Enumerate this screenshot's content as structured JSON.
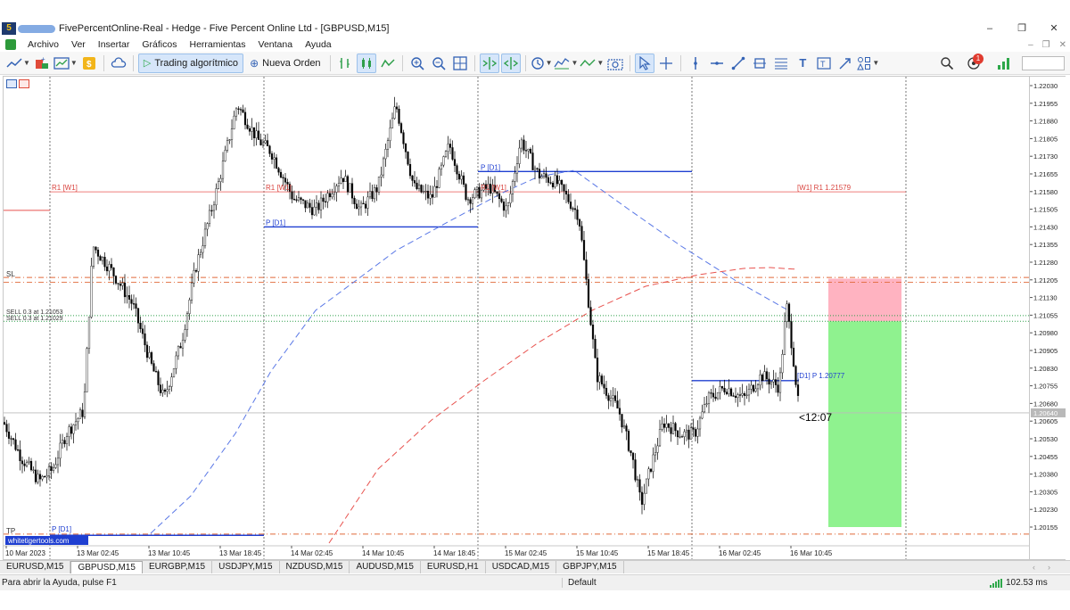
{
  "window": {
    "app_logo": "5",
    "title": "FivePercentOnline-Real - Hedge - Five Percent Online Ltd - [GBPUSD,M15]",
    "controls": [
      "–",
      "❐",
      "✕"
    ]
  },
  "menu": {
    "items": [
      "Archivo",
      "Ver",
      "Insertar",
      "Gráficos",
      "Herramientas",
      "Ventana",
      "Ayuda"
    ],
    "mdi_controls": [
      "–",
      "❐",
      "✕"
    ]
  },
  "toolbar": {
    "algo_trading_label": "Trading algorítmico",
    "new_order_label": "Nueva Orden",
    "notification_count": "1"
  },
  "chart": {
    "symbol": "GBPUSD",
    "timeframe": "M15",
    "price_axis_labels": [
      "1.22030",
      "1.21955",
      "1.21880",
      "1.21805",
      "1.21730",
      "1.21655",
      "1.21580",
      "1.21505",
      "1.21430",
      "1.21355",
      "1.21280",
      "1.21205",
      "1.21130",
      "1.21055",
      "1.20980",
      "1.20905",
      "1.20830",
      "1.20755",
      "1.20680",
      "1.20605",
      "1.20530",
      "1.20455",
      "1.20380",
      "1.20305",
      "1.20230",
      "1.20155"
    ],
    "current_price_label": "1.20640",
    "time_axis_labels": [
      "10 Mar 2023",
      "13 Mar 02:45",
      "13 Mar 10:45",
      "13 Mar 18:45",
      "14 Mar 02:45",
      "14 Mar 10:45",
      "14 Mar 18:45",
      "15 Mar 02:45",
      "15 Mar 10:45",
      "15 Mar 18:45",
      "16 Mar 02:45",
      "16 Mar 10:45"
    ],
    "countdown": "<12:07",
    "watermark": "whitetigertools.com",
    "level_labels": {
      "r1_w1_left": "R1 [W1]",
      "r1_w1_mid1": "R1 [W1]",
      "r1_w1_mid2": "R1 [W1]",
      "r1_w1_right": "[W1] R1 1.21579",
      "p_d1_1": "P [D1]",
      "p_d1_2": "P [D1]",
      "p_d1_3": "P [D1]",
      "p_d1_right": "[D1] P 1.20777",
      "sl": "SL",
      "tp": "TP",
      "sell1": "SELL 0.3 at 1.21053",
      "sell2": "SELL 0.3 at 1.21029"
    }
  },
  "tabs": [
    "EURUSD,M15",
    "GBPUSD,M15",
    "EURGBP,M15",
    "USDJPY,M15",
    "NZDUSD,M15",
    "AUDUSD,M15",
    "EURUSD,H1",
    "USDCAD,M15",
    "GBPJPY,M15"
  ],
  "active_tab_index": 1,
  "status": {
    "help": "Para abrir la Ayuda, pulse F1",
    "profile": "Default",
    "ping": "102.53 ms"
  },
  "colors": {
    "bull_candle": "#ffffff",
    "bear_candle": "#000000",
    "pivot_blue": "#1f3fd1",
    "resistance_red": "#e8534f",
    "ma_blue": "#5a78e6",
    "ma_red": "#e8534f",
    "sl_zone": "#ffb3c1",
    "tp_zone": "#8ff28f",
    "signal_green": "#2ea84a"
  }
}
